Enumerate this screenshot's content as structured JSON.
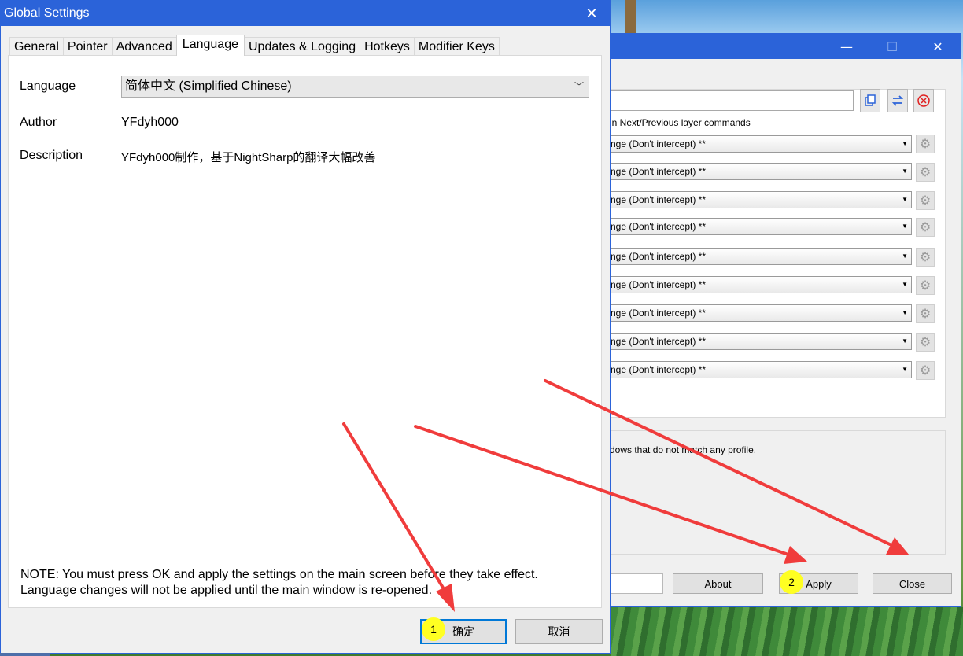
{
  "dialog": {
    "title": "Global Settings",
    "tabs": [
      {
        "label": "General"
      },
      {
        "label": "Pointer"
      },
      {
        "label": "Advanced"
      },
      {
        "label": "Language"
      },
      {
        "label": "Updates & Logging"
      },
      {
        "label": "Hotkeys"
      },
      {
        "label": "Modifier Keys"
      }
    ],
    "active_tab": "Language",
    "language_label": "Language",
    "language_value": "简体中文 (Simplified Chinese)",
    "author_label": "Author",
    "author_value": "YFdyh000",
    "description_label": "Description",
    "description_value": "YFdyh000制作，基于NightSharp的翻译大幅改善",
    "note_line1": "NOTE: You must press OK and apply the settings on the main screen before they take effect.",
    "note_line2": "Language changes will not be applied until the main window is re-opened.",
    "ok_label": "确定",
    "cancel_label": "取消"
  },
  "main_window": {
    "layer_note": "in Next/Previous layer commands",
    "rows": [
      "nge (Don't intercept) **",
      "nge (Don't intercept) **",
      "nge (Don't intercept) **",
      "nge (Don't intercept) **",
      "nge (Don't intercept) **",
      "nge (Don't intercept) **",
      "nge (Don't intercept) **",
      "nge (Don't intercept) **",
      "nge (Don't intercept) **"
    ],
    "windows_note": "dows that do not match any profile.",
    "about_label": "About",
    "apply_label": "Apply",
    "close_label": "Close"
  },
  "annotations": {
    "step1": "1",
    "step2": "2",
    "arrow_color": "#f03c3c",
    "badge_color": "#ffff22"
  }
}
